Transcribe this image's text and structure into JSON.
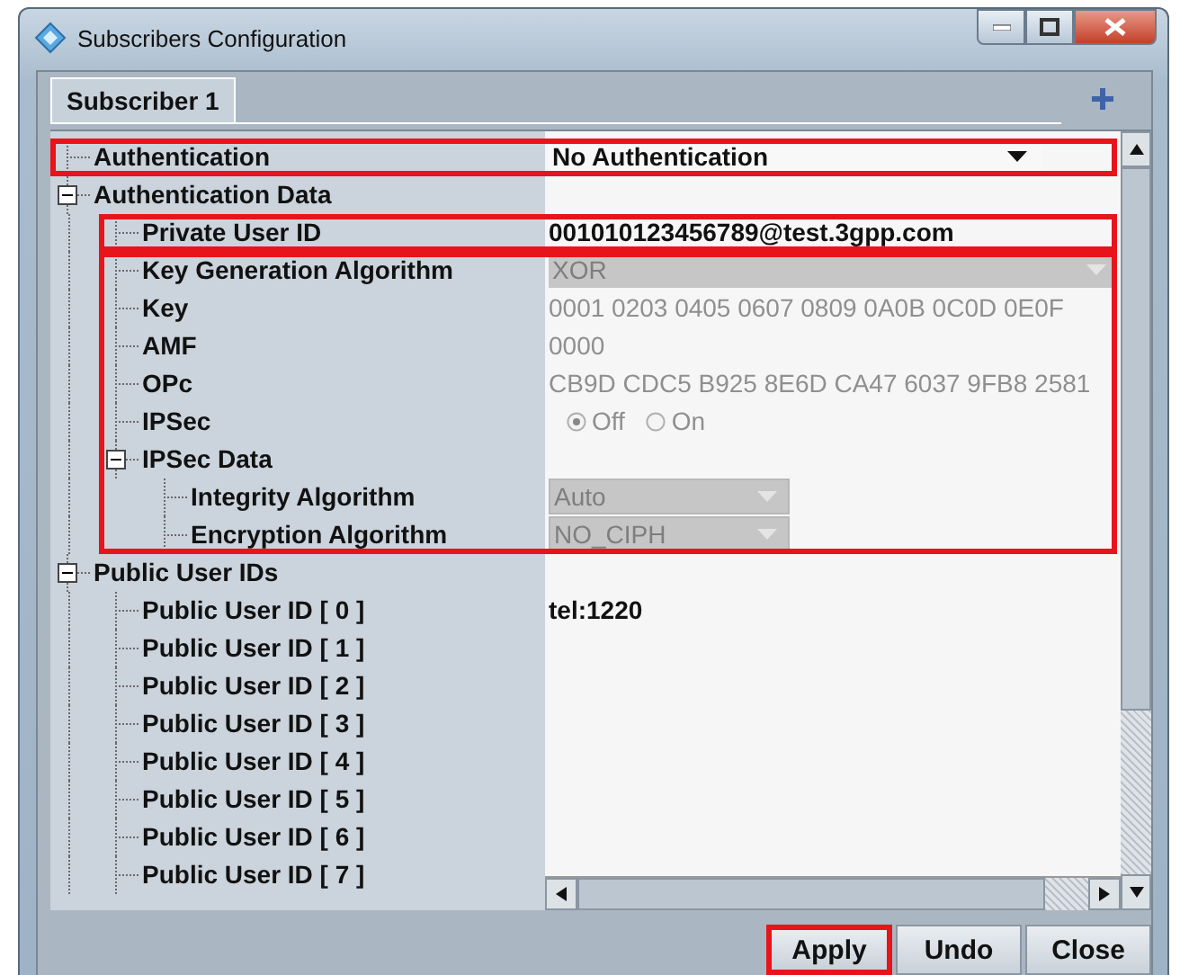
{
  "window": {
    "title": "Subscribers Configuration"
  },
  "tabs": [
    {
      "label": "Subscriber 1",
      "selected": true
    }
  ],
  "tree": [
    {
      "label": "Authentication",
      "kind": "dropdown",
      "value": "No Authentication",
      "disabled": false,
      "highlight_start": true,
      "highlight_end": true
    },
    {
      "label": "Authentication Data",
      "kind": "group",
      "expanded": true,
      "children": [
        {
          "label": "Private User ID",
          "kind": "text",
          "value": "001010123456789@test.3gpp.com",
          "disabled": false,
          "highlight_start": true,
          "highlight_end": true
        },
        {
          "label": "Key Generation Algorithm",
          "kind": "dropdown",
          "value": "XOR",
          "disabled": true,
          "highlight_start": true
        },
        {
          "label": "Key",
          "kind": "text",
          "value": "0001 0203 0405 0607 0809 0A0B 0C0D 0E0F",
          "disabled": true
        },
        {
          "label": "AMF",
          "kind": "text",
          "value": "0000",
          "disabled": true
        },
        {
          "label": "OPc",
          "kind": "text",
          "value": "CB9D CDC5 B925 8E6D CA47 6037 9FB8 2581",
          "disabled": true
        },
        {
          "label": "IPSec",
          "kind": "radio",
          "disabled": true,
          "options": [
            {
              "label": "Off",
              "selected": true
            },
            {
              "label": "On",
              "selected": false
            }
          ]
        },
        {
          "label": "IPSec Data",
          "kind": "group",
          "expanded": true,
          "children": [
            {
              "label": "Integrity Algorithm",
              "kind": "dropdown",
              "value": "Auto",
              "disabled": true
            },
            {
              "label": "Encryption Algorithm",
              "kind": "dropdown",
              "value": "NO_CIPH",
              "disabled": true,
              "highlight_end": true
            }
          ]
        }
      ]
    },
    {
      "label": "Public User IDs",
      "kind": "group",
      "expanded": true,
      "children": [
        {
          "label": "Public User ID [ 0 ]",
          "kind": "text",
          "value": "tel:1220",
          "disabled": false
        },
        {
          "label": "Public User ID [ 1 ]",
          "kind": "text"
        },
        {
          "label": "Public User ID [ 2 ]",
          "kind": "text"
        },
        {
          "label": "Public User ID [ 3 ]",
          "kind": "text"
        },
        {
          "label": "Public User ID [ 4 ]",
          "kind": "text"
        },
        {
          "label": "Public User ID [ 5 ]",
          "kind": "text"
        },
        {
          "label": "Public User ID [ 6 ]",
          "kind": "text"
        },
        {
          "label": "Public User ID [ 7 ]",
          "kind": "text"
        }
      ]
    }
  ],
  "buttons": [
    {
      "label": "Apply",
      "highlighted": true
    },
    {
      "label": "Undo",
      "highlighted": false
    },
    {
      "label": "Close",
      "highlighted": false
    }
  ]
}
